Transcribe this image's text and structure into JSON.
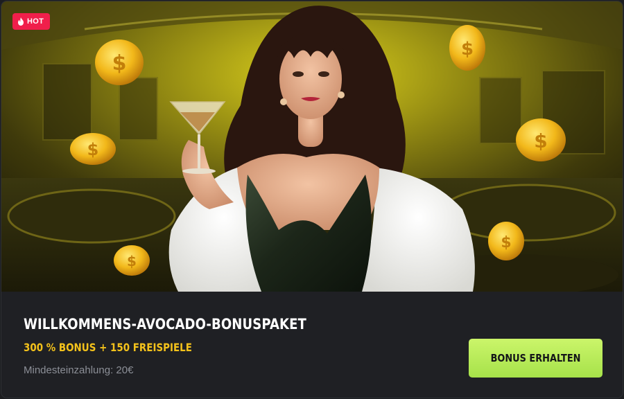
{
  "badge": {
    "label": "HOT",
    "icon": "flame-icon",
    "color": "#f01f4b"
  },
  "promo": {
    "title": "WILLKOMMENS-AVOCADO-BONUSPAKET",
    "subtitle": "300 % BONUS + 150 FREISPIELE",
    "min_deposit": "Mindesteinzahlung: 20€"
  },
  "cta": {
    "label": "BONUS ERHALTEN",
    "color": "#b8ec58"
  },
  "colors": {
    "accent": "#f4c21b",
    "background": "#1f2024",
    "title": "#ffffff"
  }
}
